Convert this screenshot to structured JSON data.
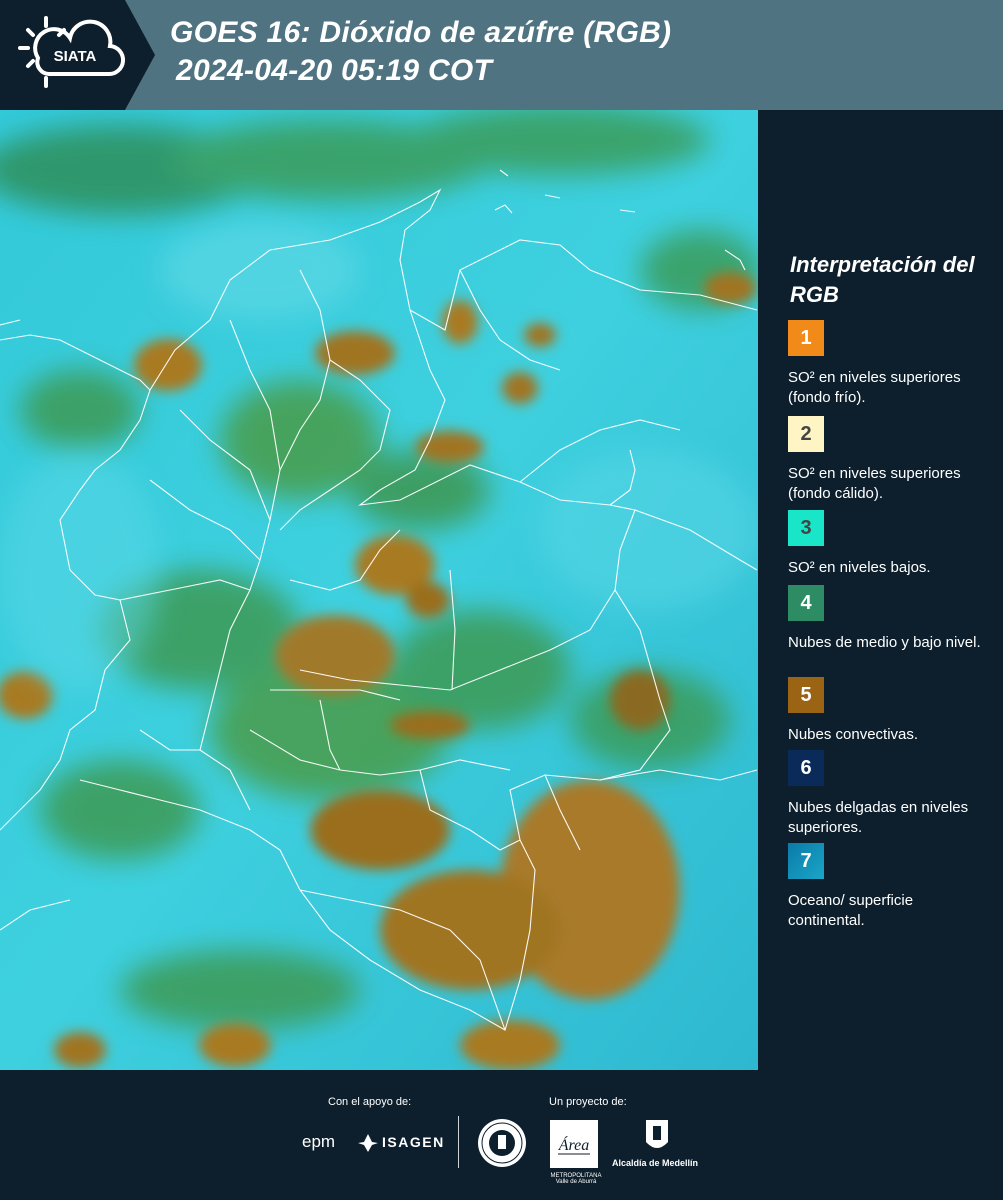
{
  "header": {
    "logo_text": "SIATA",
    "title": "GOES 16: Dióxido de azúfre (RGB)",
    "timestamp": "2024-04-20 05:19 COT",
    "background": "#4f7381"
  },
  "legend": {
    "title": "Interpretación del RGB",
    "items": [
      {
        "number": "1",
        "color": "#f28a1a",
        "label": "SO² en niveles superiores (fondo frío)."
      },
      {
        "number": "2",
        "color": "#fff5c4",
        "label": "SO² en niveles superiores (fondo cálido)."
      },
      {
        "number": "3",
        "color": "#19e6c8",
        "label": "SO² en niveles bajos."
      },
      {
        "number": "4",
        "color": "#2e8c64",
        "label": "Nubes de medio y bajo nivel."
      },
      {
        "number": "5",
        "color": "#9a6414",
        "label": "Nubes convectivas."
      },
      {
        "number": "6",
        "color": "#0a2a5a",
        "label": "Nubes delgadas en niveles superiores."
      },
      {
        "number": "7",
        "color": "#0f8fb4",
        "label": "Oceano/ superficie continental."
      }
    ]
  },
  "footer": {
    "support_label": "Con el apoyo de:",
    "project_label": "Un proyecto de:",
    "sponsors": [
      "epm",
      "ISAGEN"
    ],
    "partners": [
      "METROPOLITANA Valle de Aburrá",
      "Alcaldía de Medellín"
    ]
  },
  "map": {
    "ocean_color": "#2ec6d8",
    "cloud_color": "#a07420",
    "low_cloud_color": "#3e9a52"
  }
}
